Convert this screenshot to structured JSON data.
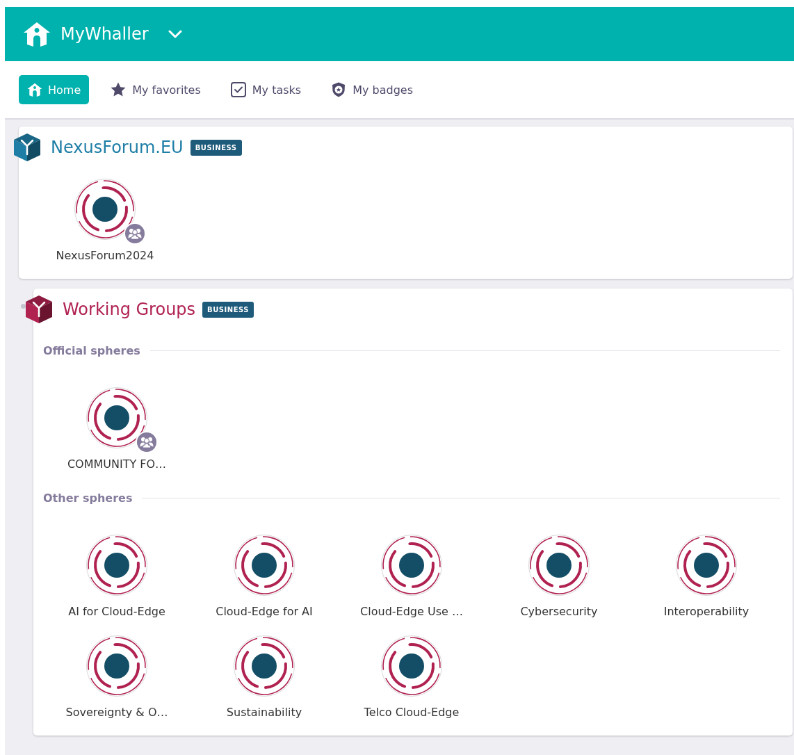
{
  "app": {
    "title": "MyWhaller"
  },
  "tabs": [
    {
      "label": "Home",
      "selected": true
    },
    {
      "label": "My favorites",
      "selected": false
    },
    {
      "label": "My tasks",
      "selected": false
    },
    {
      "label": "My badges",
      "selected": false
    }
  ],
  "organizations": [
    {
      "name": "NexusForum.EU",
      "color": "#1e7ea6",
      "tag": "BUSINESS",
      "sections": [
        {
          "spheres": [
            {
              "name": "NexusForum2024",
              "group": true
            }
          ]
        }
      ]
    },
    {
      "name": "Working Groups",
      "color": "#b02250",
      "tag": "BUSINESS",
      "sections": [
        {
          "title": "Official spheres",
          "spheres": [
            {
              "name": "COMMUNITY FO…",
              "group": true
            }
          ]
        },
        {
          "title": "Other spheres",
          "spheres": [
            {
              "name": "AI for Cloud-Edge",
              "group": false
            },
            {
              "name": "Cloud-Edge for AI",
              "group": false
            },
            {
              "name": "Cloud-Edge Use …",
              "group": false
            },
            {
              "name": "Cybersecurity",
              "group": false
            },
            {
              "name": "Interoperability",
              "group": false
            },
            {
              "name": "Sovereignty & O…",
              "group": false
            },
            {
              "name": "Sustainability",
              "group": false
            },
            {
              "name": "Telco Cloud-Edge",
              "group": false
            }
          ]
        }
      ]
    }
  ]
}
